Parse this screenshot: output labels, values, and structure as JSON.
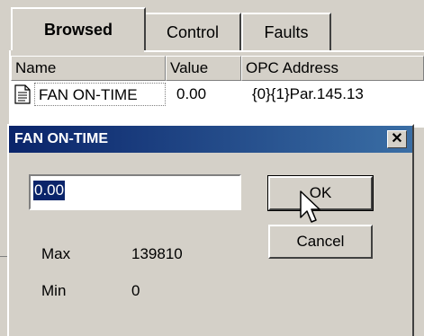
{
  "tabs": [
    {
      "label": "Browsed",
      "active": true
    },
    {
      "label": "Control",
      "active": false
    },
    {
      "label": "Faults",
      "active": false
    }
  ],
  "list": {
    "columns": [
      "Name",
      "Value",
      "OPC Address"
    ],
    "rows": [
      {
        "icon": "document-icon",
        "name": "FAN ON-TIME",
        "value": "0.00",
        "address": "{0}{1}Par.145.13"
      }
    ]
  },
  "dialog": {
    "title": "FAN ON-TIME",
    "input_value": "0.00",
    "ok_label": "OK",
    "cancel_label": "Cancel",
    "max_label": "Max",
    "max_value": "139810",
    "min_label": "Min",
    "min_value": "0"
  },
  "colors": {
    "face": "#d4d0c8",
    "titlebar_start": "#0a246a",
    "titlebar_end": "#3a6ea5",
    "selection": "#0a246a"
  }
}
